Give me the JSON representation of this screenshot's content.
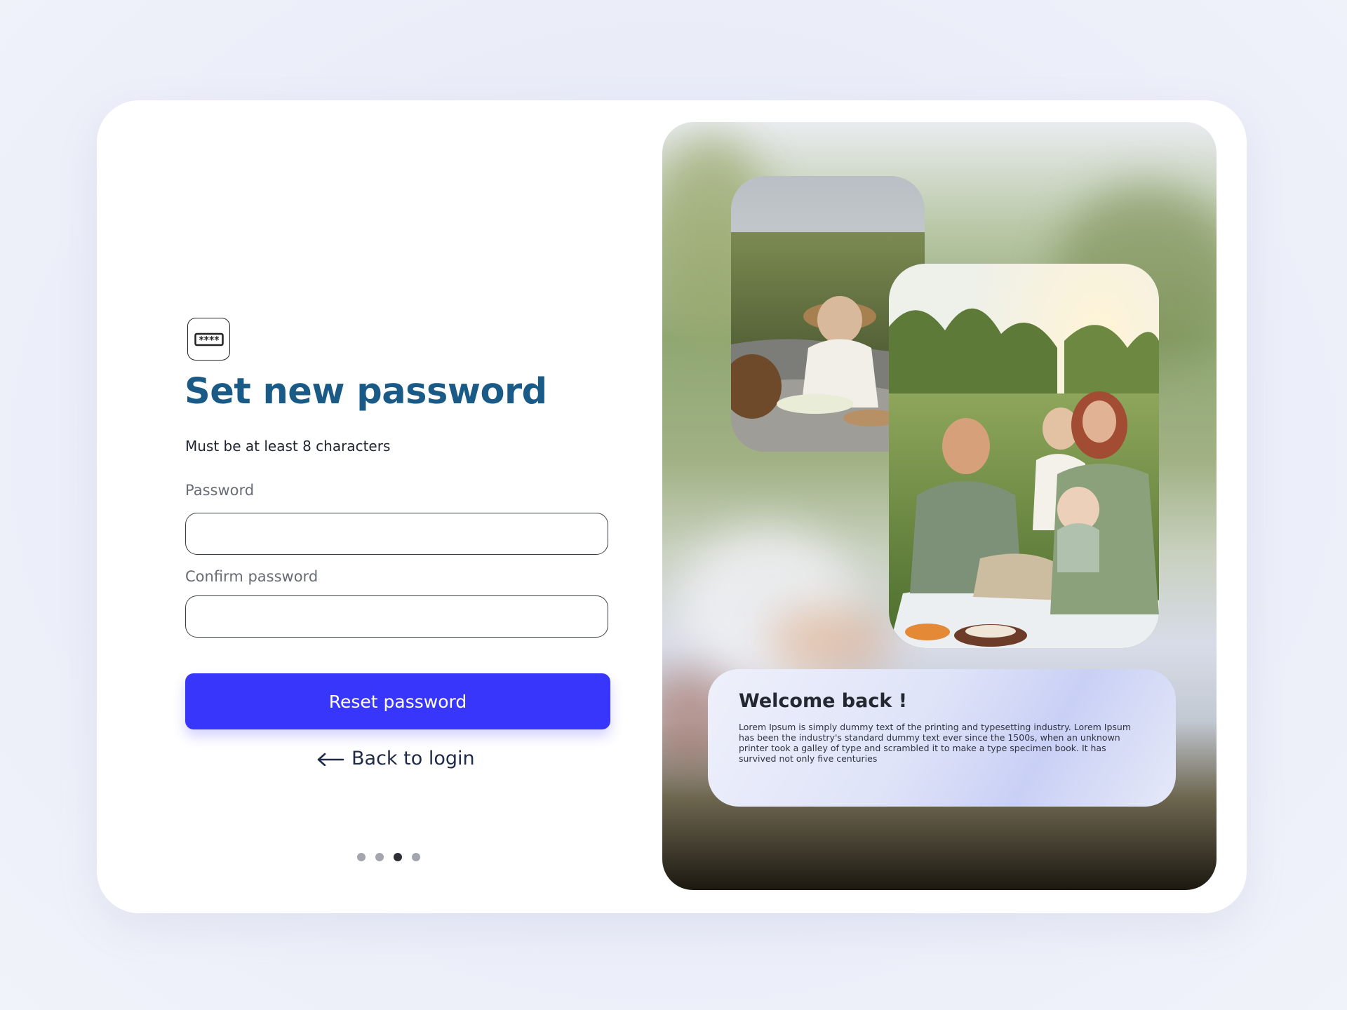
{
  "auth": {
    "icon": "password-key-icon",
    "title": "Set new password",
    "subtitle": "Must be at least 8 characters",
    "password_label": "Password",
    "password_value": "",
    "confirm_label": "Confirm password",
    "confirm_value": "",
    "submit_label": "Reset password",
    "back_label": "Back to login",
    "back_icon": "arrow-left-icon",
    "pagination": {
      "total": 4,
      "active_index": 2
    }
  },
  "promo": {
    "title": "Welcome back !",
    "body": "Lorem Ipsum is simply dummy text of the printing and typesetting industry. Lorem Ipsum has been the industry's standard dummy text ever since the 1500s, when an unknown printer took a galley of type and scrambled it to make a type specimen book. It has survived not only five centuries",
    "photos": [
      "baby-picnic-photo",
      "family-picnic-photo"
    ]
  },
  "colors": {
    "title": "#1a5a86",
    "primary_button": "#3936fb",
    "dot_active": "#2e3036",
    "dot_inactive": "#a3a6ad"
  }
}
